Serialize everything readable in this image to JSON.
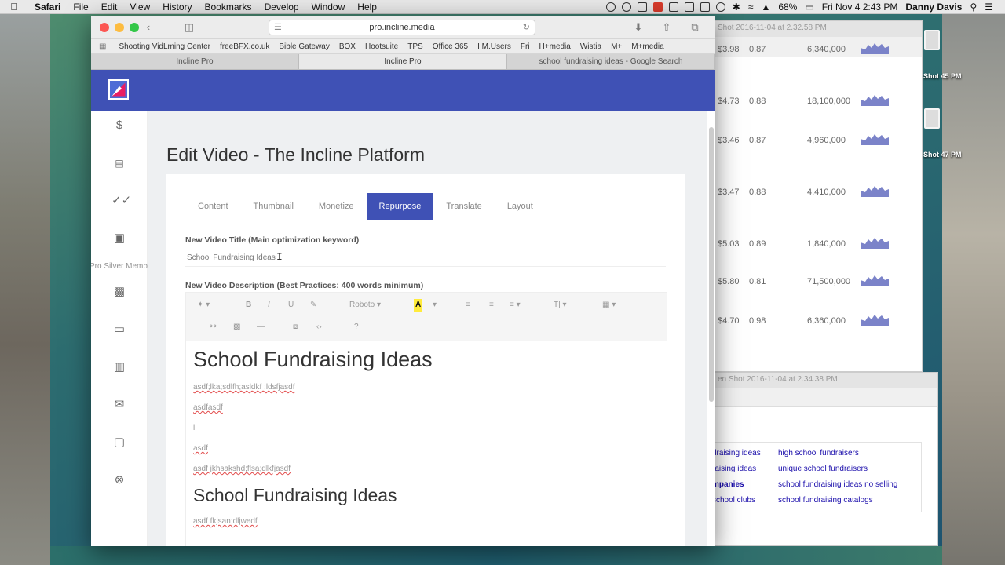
{
  "menubar": {
    "app": "Safari",
    "items": [
      "File",
      "Edit",
      "View",
      "History",
      "Bookmarks",
      "Develop",
      "Window",
      "Help"
    ],
    "battery": "68%",
    "datetime": "Fri Nov 4  2:43 PM",
    "user": "Danny Davis"
  },
  "browser": {
    "url": "pro.incline.media",
    "favorites": [
      "Shooting VidLming Center",
      "freeBFX.co.uk",
      "Bible Gateway",
      "BOX",
      "Hootsuite",
      "TPS",
      "Office 365",
      "I M.Users",
      "Fri",
      "H+media",
      "Wistia",
      "M+",
      "M+media"
    ],
    "tabs": [
      "Incline Pro",
      "Incline Pro",
      "school fundraising ideas - Google Search"
    ]
  },
  "sidebar": {
    "hover_tooltip": "Pro Silver Membership"
  },
  "page": {
    "title": "Edit Video - The Incline Platform",
    "tabs": [
      "Content",
      "Thumbnail",
      "Monetize",
      "Repurpose",
      "Translate",
      "Layout"
    ],
    "active_tab": "Repurpose",
    "title_label": "New Video Title (Main optimization keyword)",
    "title_value": "School Fundraising Ideas",
    "desc_label": "New Video Description (Best Practices: 400 words minimum)",
    "toolbar": {
      "font": "Roboto",
      "bold": "B",
      "italic": "I",
      "underline": "U",
      "color": "A",
      "size": "T|"
    },
    "editor": {
      "heading1": "School Fundraising Ideas",
      "lines": [
        "asdf;lka;sdlfh;asldkf ;ldsfjasdf",
        "asdfasdf",
        "l",
        "asdf",
        "asdf jkhsakshd;flsa;dlkfjasdf"
      ],
      "heading2": "School Fundraising Ideas",
      "line_after": "asdf fkjsan;dljwedf"
    }
  },
  "background_search": {
    "window1_title": "Shot 2016-11-04 at 2.32.58 PM",
    "window2_title": "en Shot 2016-11-04 at 2.34.38 PM",
    "rows": [
      {
        "cpc": "$3.98",
        "comp": "0.87",
        "vol": "6,340,000"
      },
      {
        "cpc": "$4.73",
        "comp": "0.88",
        "vol": "18,100,000"
      },
      {
        "cpc": "$3.46",
        "comp": "0.87",
        "vol": "4,960,000"
      },
      {
        "cpc": "$3.47",
        "comp": "0.88",
        "vol": "4,410,000"
      },
      {
        "cpc": "$5.03",
        "comp": "0.89",
        "vol": "1,840,000"
      },
      {
        "cpc": "$5.80",
        "comp": "0.81",
        "vol": "71,500,000"
      },
      {
        "cpc": "$4.70",
        "comp": "0.98",
        "vol": "6,360,000"
      }
    ],
    "related": {
      "left": [
        "draising ideas",
        "raising ideas",
        "mpanies",
        "school clubs"
      ],
      "right": [
        "high school fundraisers",
        "unique school fundraisers",
        "school fundraising ideas no selling",
        "school fundraising catalogs"
      ]
    }
  },
  "desktop_labels": [
    "Shot 45 PM",
    "Shot 47 PM"
  ],
  "colors": {
    "primary": "#3f51b5",
    "highlight": "#ffeb3b"
  }
}
